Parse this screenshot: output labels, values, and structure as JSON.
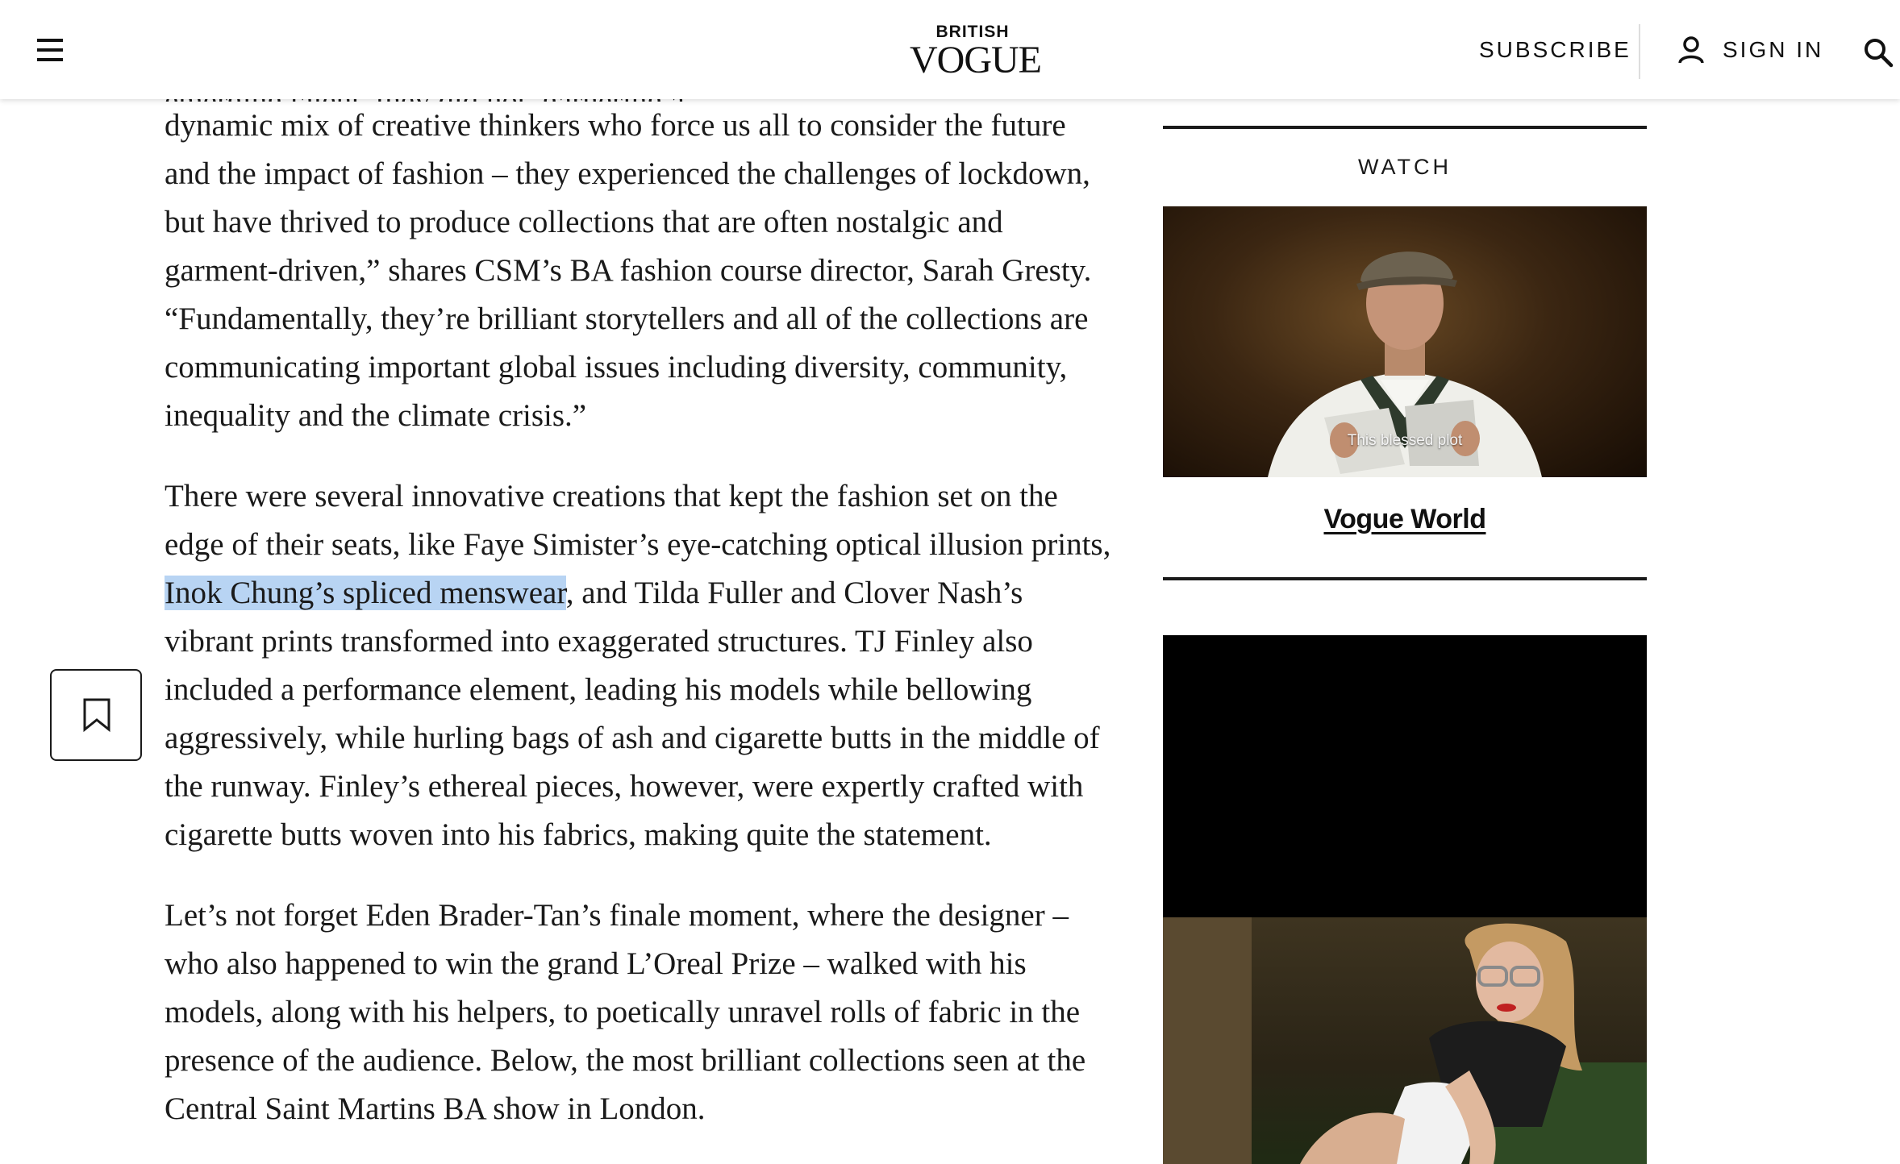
{
  "header": {
    "brand_kicker": "BRITISH",
    "brand_name": "VOGUE",
    "subscribe_label": "SUBSCRIBE",
    "signin_label": "SIGN IN",
    "icons": [
      "menu-icon",
      "user-icon",
      "search-icon"
    ]
  },
  "article": {
    "lead_fragment": "emerging talent, they did not, garnering a",
    "paragraph_1": "dynamic mix of creative thinkers who force us all to consider the future and the impact of fashion – they experienced the challenges of lockdown, but have thrived to produce collections that are often nostalgic and garment-driven,” shares CSM’s BA fashion course director, Sarah Gresty. “Fundamentally, they’re brilliant storytellers and all of the collections are communicating important global issues including diversity, community, inequality and the climate crisis.”",
    "paragraph_2_before": "There were several innovative creations that kept the fashion set on the edge of their seats, like Faye Simister’s eye-catching optical illusion prints, ",
    "paragraph_2_highlight": "Inok Chung’s spliced menswear",
    "paragraph_2_after": ", and Tilda Fuller and Clover Nash’s vibrant prints transformed into exaggerated structures. TJ Finley also included a performance element, leading his models while bellowing aggressively, while hurling bags of ash and cigarette butts in the middle of the runway. Finley’s ethereal pieces, however, were expertly crafted with cigarette butts woven into his fabrics, making quite the statement.",
    "paragraph_3": "Let’s not forget Eden Brader-Tan’s finale moment, where the designer – who also happened to win the grand L’Oreal Prize – walked with his models, along with his helpers, to poetically unravel rolls of fabric in the presence of the audience. Below, the most brilliant collections seen at the Central Saint Martins BA show in London.",
    "highlight_color": "#b8d4f3"
  },
  "sidebar": {
    "watch_label": "WATCH",
    "video_caption": "This blessed plot",
    "video_link": "Vogue World"
  },
  "bookmark": {
    "icon": "bookmark-icon"
  }
}
